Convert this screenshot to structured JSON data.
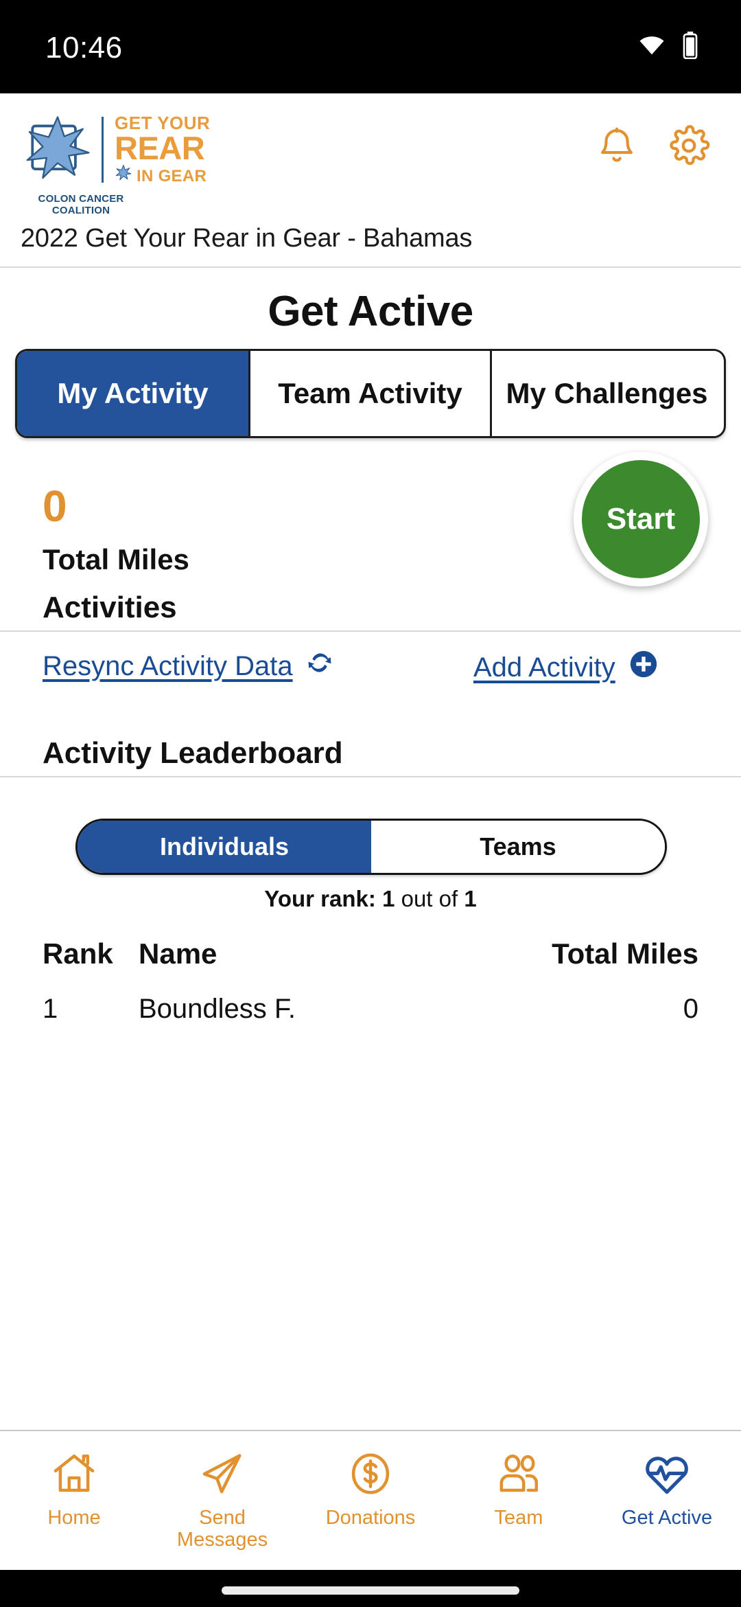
{
  "status_bar": {
    "time": "10:46",
    "icons": [
      "wifi-icon",
      "battery-icon"
    ]
  },
  "header": {
    "logo": {
      "org_line1": "COLON CANCER",
      "org_line2": "COALITION",
      "brand_line1": "GET YOUR",
      "brand_line2": "REAR",
      "brand_line3": "IN GEAR",
      "star_color": "#7BA7D7",
      "org_color": "#1F4E79",
      "brand_color": "#E89C3C"
    },
    "actions": [
      {
        "name": "notifications-button",
        "icon": "bell-icon"
      },
      {
        "name": "settings-button",
        "icon": "gear-icon"
      }
    ],
    "event_title": "2022 Get Your Rear in Gear - Bahamas"
  },
  "main": {
    "page_title": "Get Active",
    "tabs": [
      {
        "label": "My Activity",
        "active": true
      },
      {
        "label": "Team Activity",
        "active": false
      },
      {
        "label": "My Challenges",
        "active": false
      }
    ],
    "summary": {
      "total_value": "0",
      "total_label": "Total Miles",
      "start_button": "Start"
    },
    "activities": {
      "heading": "Activities",
      "resync_link": "Resync Activity Data",
      "resync_icon": "refresh-icon",
      "add_link": "Add Activity",
      "add_icon": "plus-circle-icon"
    },
    "leaderboard": {
      "heading": "Activity Leaderboard",
      "segments": [
        {
          "label": "Individuals",
          "active": true
        },
        {
          "label": "Teams",
          "active": false
        }
      ],
      "rank_prefix": "Your rank:",
      "rank_value": "1",
      "rank_middle": "out of",
      "rank_total": "1",
      "columns": [
        "Rank",
        "Name",
        "Total Miles"
      ],
      "rows": [
        {
          "rank": "1",
          "name": "Boundless F.",
          "miles": "0"
        }
      ]
    }
  },
  "bottom_nav": [
    {
      "label": "Home",
      "icon": "home-icon",
      "active": false
    },
    {
      "label": "Send Messages",
      "icon": "paper-plane-icon",
      "active": false
    },
    {
      "label": "Donations",
      "icon": "dollar-circle-icon",
      "active": false
    },
    {
      "label": "Team",
      "icon": "people-icon",
      "active": false
    },
    {
      "label": "Get Active",
      "icon": "heart-pulse-icon",
      "active": true
    }
  ],
  "colors": {
    "accent_orange": "#E2912F",
    "accent_blue": "#24529B",
    "link_blue": "#1A4C96",
    "start_green": "#3C8A2E",
    "nav_active_blue": "#20509E"
  }
}
